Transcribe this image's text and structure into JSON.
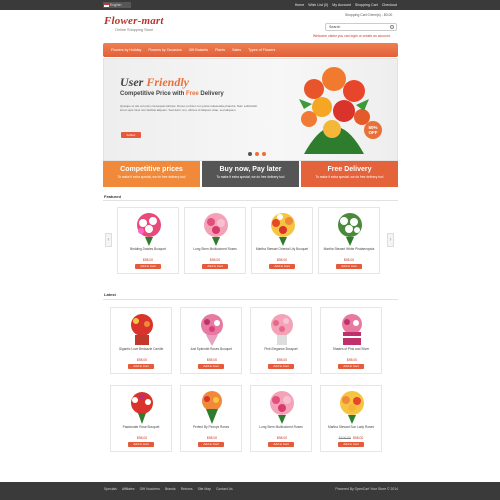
{
  "topbar": {
    "language": "English",
    "links": [
      "Home",
      "Wish List (0)",
      "My Account",
      "Shopping Cart",
      "Checkout"
    ]
  },
  "header": {
    "logo_title": "Flower-mart",
    "logo_subtitle": "Online Shopping Store",
    "cart_summary": "Shopping Cart 0 item(s) - $0.00",
    "search_placeholder": "Search",
    "welcome": "Welcome visitor you can login or create an account."
  },
  "nav": {
    "items": [
      "Flowers by Holiday",
      "Flowers by Occasion",
      "Gift Baskets",
      "Plants",
      "Sales",
      "Types of Flowers"
    ]
  },
  "banner": {
    "title_plain": "User",
    "title_accent": "Friendly",
    "subtitle_plain": "Competitive Price with",
    "subtitle_accent": "Free",
    "subtitle_end": "Delivery",
    "text": "Quisque et nisi vel enim consequat ultricies. Donec et dolor non porta malesuada pharetra. Nam sollicitudin lorem quis risus non facilisis aliquam. Sed dolor non, ultrices id aliquam vitae, sed aliquam.",
    "button": "Follow",
    "badge_pct": "50%",
    "badge_off": "OFF"
  },
  "promos": [
    {
      "title": "Competitive prices",
      "text": "To make it extra special, we do free delivery too!",
      "color": "#f08a3a"
    },
    {
      "title": "Buy now, Pay later",
      "text": "To make it extra special, we do free delivery too!",
      "color": "#555555"
    },
    {
      "title": "Free Delivery",
      "text": "To make it extra special, we do free delivery too!",
      "color": "#e4633a"
    }
  ],
  "featured": {
    "title": "Featured",
    "products": [
      {
        "name": "Bedding Daisies Bouquet",
        "price": "$98.00",
        "button": "Add to Cart"
      },
      {
        "name": "Long Stem Multicolored Roses",
        "price": "$98.00",
        "button": "Add to Cart"
      },
      {
        "name": "Martha Stewart Oriental Lily Bouquet",
        "price": "$98.00",
        "button": "Add to Cart"
      },
      {
        "name": "Martha Stewart White Phalaenopsis",
        "price": "$98.00",
        "button": "Add to Cart"
      }
    ]
  },
  "latest": {
    "title": "Latest",
    "products": [
      {
        "name": "Gigantic Love Bedazzle Candle",
        "price": "$98.00",
        "old_price": "",
        "button": "Add to Cart"
      },
      {
        "name": "Just Splendid Roses Bouquet",
        "price": "$98.00",
        "old_price": "",
        "button": "Add to Cart"
      },
      {
        "name": "Pink Elegance Bouquet",
        "price": "$98.00",
        "old_price": "",
        "button": "Add to Cart"
      },
      {
        "name": "Shades of Pink and Silver",
        "price": "$98.00",
        "old_price": "",
        "button": "Add to Cart"
      },
      {
        "name": "Passionate Rose Bouquet",
        "price": "$98.00",
        "old_price": "",
        "button": "Add to Cart"
      },
      {
        "name": "Perfect By Peonys Roses",
        "price": "$98.00",
        "old_price": "",
        "button": "Add to Cart"
      },
      {
        "name": "Long Stem Multicolored Roses",
        "price": "$98.00",
        "old_price": "",
        "button": "Add to Cart"
      },
      {
        "name": "Martha Stewart Sun Lady Roses",
        "price": "$98.00",
        "old_price": "$100.00",
        "button": "Add to Cart"
      }
    ]
  },
  "footer": {
    "links": [
      "Specials",
      "Affiliates",
      "Gift Vouchers",
      "Brands",
      "Returns",
      "Site Map",
      "Contact Us"
    ],
    "copyright": "Powered By OpenCart Your Store © 2014"
  }
}
